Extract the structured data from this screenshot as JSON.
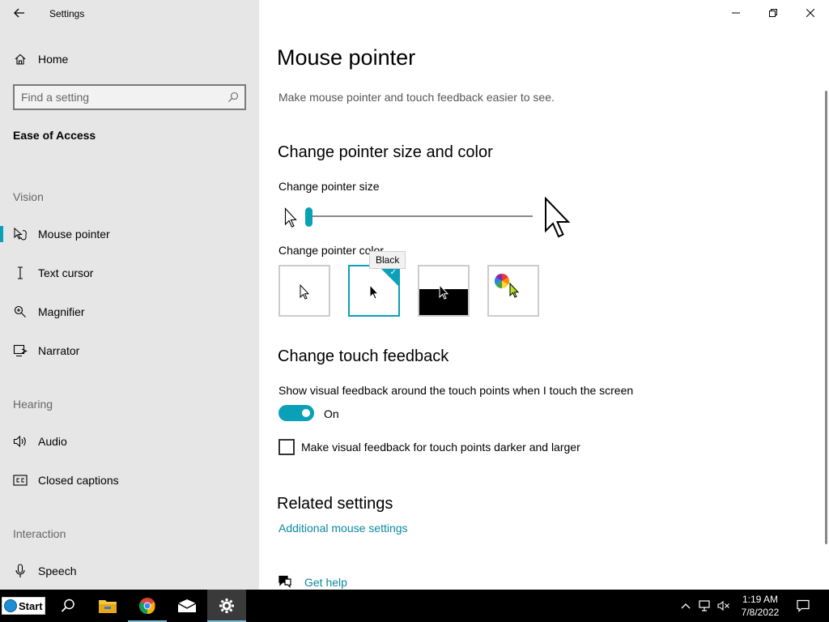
{
  "window": {
    "app_title": "Settings"
  },
  "sidebar": {
    "home_label": "Home",
    "search_placeholder": "Find a setting",
    "section_title": "Ease of Access",
    "groups": [
      {
        "label": "Vision"
      },
      {
        "label": "Hearing"
      },
      {
        "label": "Interaction"
      }
    ],
    "items": [
      {
        "label": "Mouse pointer",
        "icon": "mouse-pointer-icon",
        "active": true
      },
      {
        "label": "Text cursor",
        "icon": "text-cursor-icon"
      },
      {
        "label": "Magnifier",
        "icon": "magnifier-icon"
      },
      {
        "label": "Narrator",
        "icon": "narrator-icon"
      },
      {
        "label": "Audio",
        "icon": "speaker-icon"
      },
      {
        "label": "Closed captions",
        "icon": "closed-captions-icon"
      },
      {
        "label": "Speech",
        "icon": "microphone-icon"
      }
    ]
  },
  "main": {
    "title": "Mouse pointer",
    "description": "Make mouse pointer and touch feedback easier to see.",
    "pointer_section": {
      "heading": "Change pointer size and color",
      "size_label": "Change pointer size",
      "size_level": 0.0,
      "color_label": "Change pointer color",
      "colors": [
        {
          "name": "White",
          "selected": false
        },
        {
          "name": "Black",
          "selected": true
        },
        {
          "name": "Inverted",
          "selected": false
        },
        {
          "name": "Custom",
          "selected": false
        }
      ],
      "tooltip": "Black"
    },
    "touch_section": {
      "heading": "Change touch feedback",
      "visual_feedback_label": "Show visual feedback around the touch points when I touch the screen",
      "toggle_state": "On",
      "darker_label": "Make visual feedback for touch points darker and larger"
    },
    "related": {
      "heading": "Related settings",
      "link": "Additional mouse settings"
    },
    "help_link": "Get help"
  },
  "taskbar": {
    "start_label": "Start",
    "time": "1:19 AM",
    "date": "7/8/2022"
  },
  "colors": {
    "accent": "#0aa0b8",
    "sidebar_bg": "#e6e6e6",
    "taskbar_bg": "#000000"
  }
}
